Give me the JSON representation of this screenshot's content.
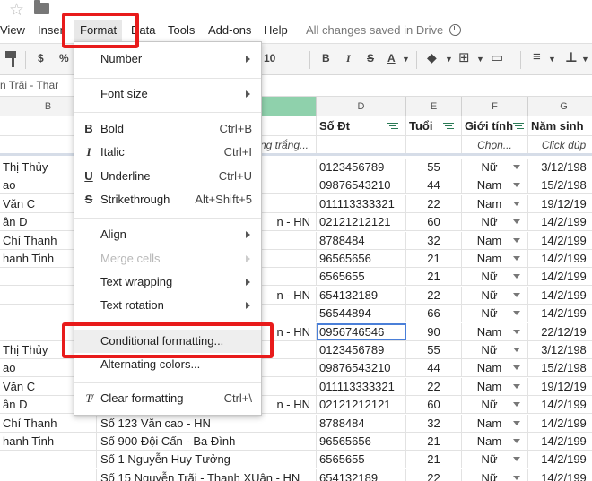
{
  "menubar": {
    "view": "View",
    "insert": "Inser",
    "format": "Format",
    "data": "Data",
    "tools": "Tools",
    "addons": "Add-ons",
    "help": "Help",
    "saved_status": "All changes saved in Drive"
  },
  "toolbar": {
    "currency": "$",
    "percent": "%",
    "font_size": "10",
    "bold": "B",
    "italic": "I",
    "strike": "S",
    "text_color": "A"
  },
  "formula_bar": {
    "text": "n Trãi - Thar"
  },
  "columns": [
    "B",
    "D",
    "E",
    "F",
    "G"
  ],
  "header_row": {
    "phone": "Số Đt",
    "age": "Tuổi",
    "gender": "Giới tính",
    "birth": "Năm sinh"
  },
  "hint_row": {
    "c_hint": "ng trắng...",
    "gender_hint": "Chọn...",
    "birth_hint": "Click đúp"
  },
  "rows": [
    {
      "b": "Thị Thủy",
      "c": "",
      "d": "0123456789",
      "e": "55",
      "f": "Nữ",
      "g": "3/12/198"
    },
    {
      "b": "ao",
      "c": "",
      "d": "09876543210",
      "e": "44",
      "f": "Nam",
      "g": "15/2/198"
    },
    {
      "b": "Văn C",
      "c": "",
      "d": "011113333321",
      "e": "22",
      "f": "Nam",
      "g": "19/12/19"
    },
    {
      "b": "ân D",
      "c": "n - HN",
      "d": "02121212121",
      "e": "60",
      "f": "Nữ",
      "g": "14/2/199"
    },
    {
      "b": "Chí Thanh",
      "c": "",
      "d": "8788484",
      "e": "32",
      "f": "Nam",
      "g": "14/2/199"
    },
    {
      "b": "hanh Tinh",
      "c": "",
      "d": "96565656",
      "e": "21",
      "f": "Nam",
      "g": "14/2/199"
    },
    {
      "b": "",
      "c": "",
      "d": "6565655",
      "e": "21",
      "f": "Nữ",
      "g": "14/2/199"
    },
    {
      "b": "",
      "c": "n - HN",
      "d": "654132189",
      "e": "22",
      "f": "Nữ",
      "g": "14/2/199"
    },
    {
      "b": "",
      "c": "",
      "d": "56544894",
      "e": "66",
      "f": "Nữ",
      "g": "14/2/199"
    },
    {
      "b": "",
      "c": "n - HN",
      "d": "0956746546",
      "e": "90",
      "f": "Nam",
      "g": "22/12/19"
    },
    {
      "b": "Thị Thủy",
      "c": "",
      "d": "0123456789",
      "e": "55",
      "f": "Nữ",
      "g": "3/12/198"
    },
    {
      "b": "ao",
      "c": "",
      "d": "09876543210",
      "e": "44",
      "f": "Nam",
      "g": "15/2/198"
    },
    {
      "b": "Văn C",
      "c": "",
      "d": "011113333321",
      "e": "22",
      "f": "Nam",
      "g": "19/12/19"
    },
    {
      "b": "ân D",
      "c": "n - HN",
      "d": "02121212121",
      "e": "60",
      "f": "Nữ",
      "g": "14/2/199"
    },
    {
      "b": "Chí Thanh",
      "c": "Số 123 Văn cao - HN",
      "d": "8788484",
      "e": "32",
      "f": "Nam",
      "g": "14/2/199"
    },
    {
      "b": "hanh Tinh",
      "c": "Số 900 Đội Cấn - Ba Đình",
      "d": "96565656",
      "e": "21",
      "f": "Nam",
      "g": "14/2/199"
    },
    {
      "b": "",
      "c": "Số 1 Nguyễn Huy Tưởng",
      "d": "6565655",
      "e": "21",
      "f": "Nữ",
      "g": "14/2/199"
    },
    {
      "b": "",
      "c": "Số 15 Nguyễn Trãi - Thanh XUân - HN",
      "d": "654132189",
      "e": "22",
      "f": "Nữ",
      "g": "14/2/199"
    }
  ],
  "format_menu": {
    "number": "Number",
    "font_size": "Font size",
    "bold": "Bold",
    "bold_sc": "Ctrl+B",
    "italic": "Italic",
    "italic_sc": "Ctrl+I",
    "underline": "Underline",
    "underline_sc": "Ctrl+U",
    "strike": "Strikethrough",
    "strike_sc": "Alt+Shift+5",
    "align": "Align",
    "merge": "Merge cells",
    "wrap": "Text wrapping",
    "rotation": "Text rotation",
    "conditional": "Conditional formatting...",
    "alternating": "Alternating colors...",
    "clear": "Clear formatting",
    "clear_sc": "Ctrl+\\"
  },
  "colors": {
    "highlight_red": "#e81b1b",
    "selected_col": "#8fd1ac",
    "filter_green": "#2a7a55"
  }
}
